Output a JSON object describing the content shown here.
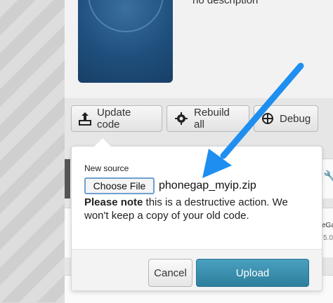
{
  "app": {
    "description": "no description"
  },
  "toolbar": {
    "update_label": "Update code",
    "rebuild_label": "Rebuild all",
    "debug_label": "Debug"
  },
  "popup": {
    "label": "New source",
    "choose_file_label": "Choose File",
    "file_name": "phonegap_myip.zip",
    "note_bold": "Please note",
    "note_text": " this is a destructive action. We won't keep a copy of your old code.",
    "cancel_label": "Cancel",
    "upload_label": "Upload"
  },
  "background": {
    "side_text_1": "eGa",
    "side_text_2": "5.0"
  },
  "colors": {
    "upload": "#3a8fb0",
    "arrow": "#1e8ff0",
    "icon_bg": "#1f4f7d"
  }
}
